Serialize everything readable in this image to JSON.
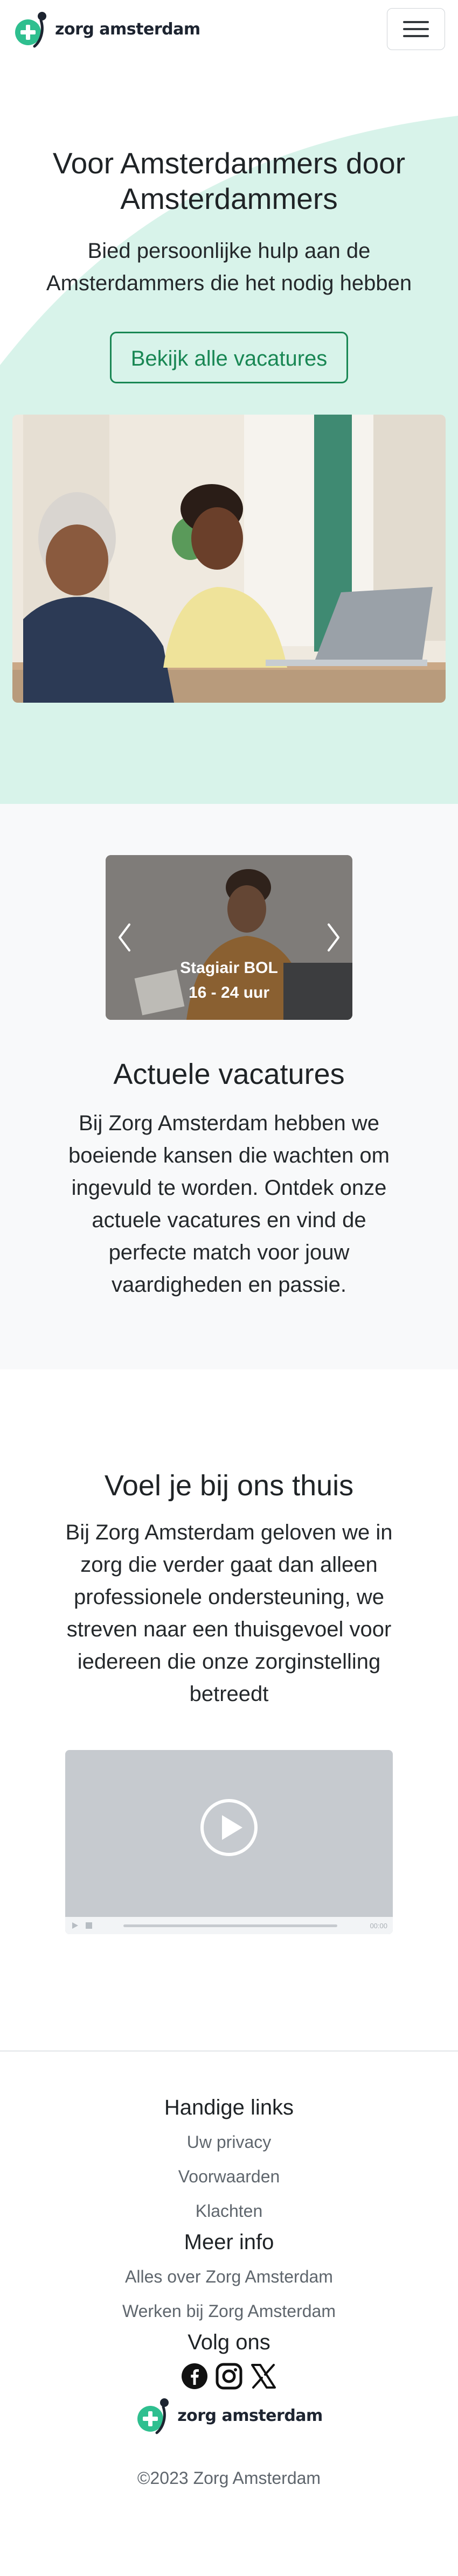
{
  "navbar": {
    "brand": "zorg amsterdam",
    "toggler_icon": "hamburger-menu-icon"
  },
  "hero": {
    "title": "Voor Amsterdammers door Amsterdammers",
    "subtitle": "Bied persoonlijke hulp aan de Amsterdammers die het nodig hebben",
    "cta_label": "Bekijk alle vacatures",
    "photo": "elderly-man-and-woman-at-laptop-photo",
    "accent_bg": "#d8f3ea"
  },
  "vacatures": {
    "carousel": {
      "title": "Stagiair BOL",
      "subtitle": "16 - 24 uur",
      "prev_icon": "chevron-left-icon",
      "next_icon": "chevron-right-icon"
    },
    "title": "Actuele vacatures",
    "text": "Bij Zorg Amsterdam hebben we boeiende kansen die wachten om ingevuld te worden. Ontdek onze actuele vacatures en vind de perfecte match voor jouw vaardigheden en passie."
  },
  "thuis": {
    "title": "Voel je bij ons thuis",
    "text": "Bij Zorg Amsterdam geloven we in zorg die verder gaat dan alleen professionele ondersteuning, we streven naar een thuisgevoel voor iedereen die onze zorginstelling betreedt",
    "video": {
      "play_icon": "play-icon",
      "time": "00:00"
    }
  },
  "footer": {
    "handige_links_title": "Handige links",
    "handige_links": [
      "Uw privacy",
      "Voorwaarden",
      "Klachten"
    ],
    "meer_info_title": "Meer info",
    "meer_info": [
      "Alles over Zorg Amsterdam",
      "Werken bij Zorg Amsterdam"
    ],
    "volg_ons_title": "Volg ons",
    "socials": [
      "facebook-icon",
      "instagram-icon",
      "x-icon"
    ],
    "brand": "zorg amsterdam",
    "copyright": "©2023 Zorg Amsterdam"
  },
  "colors": {
    "accent": "#198754",
    "brand_green": "#2fbf8f",
    "brand_dark": "#1d2430"
  }
}
